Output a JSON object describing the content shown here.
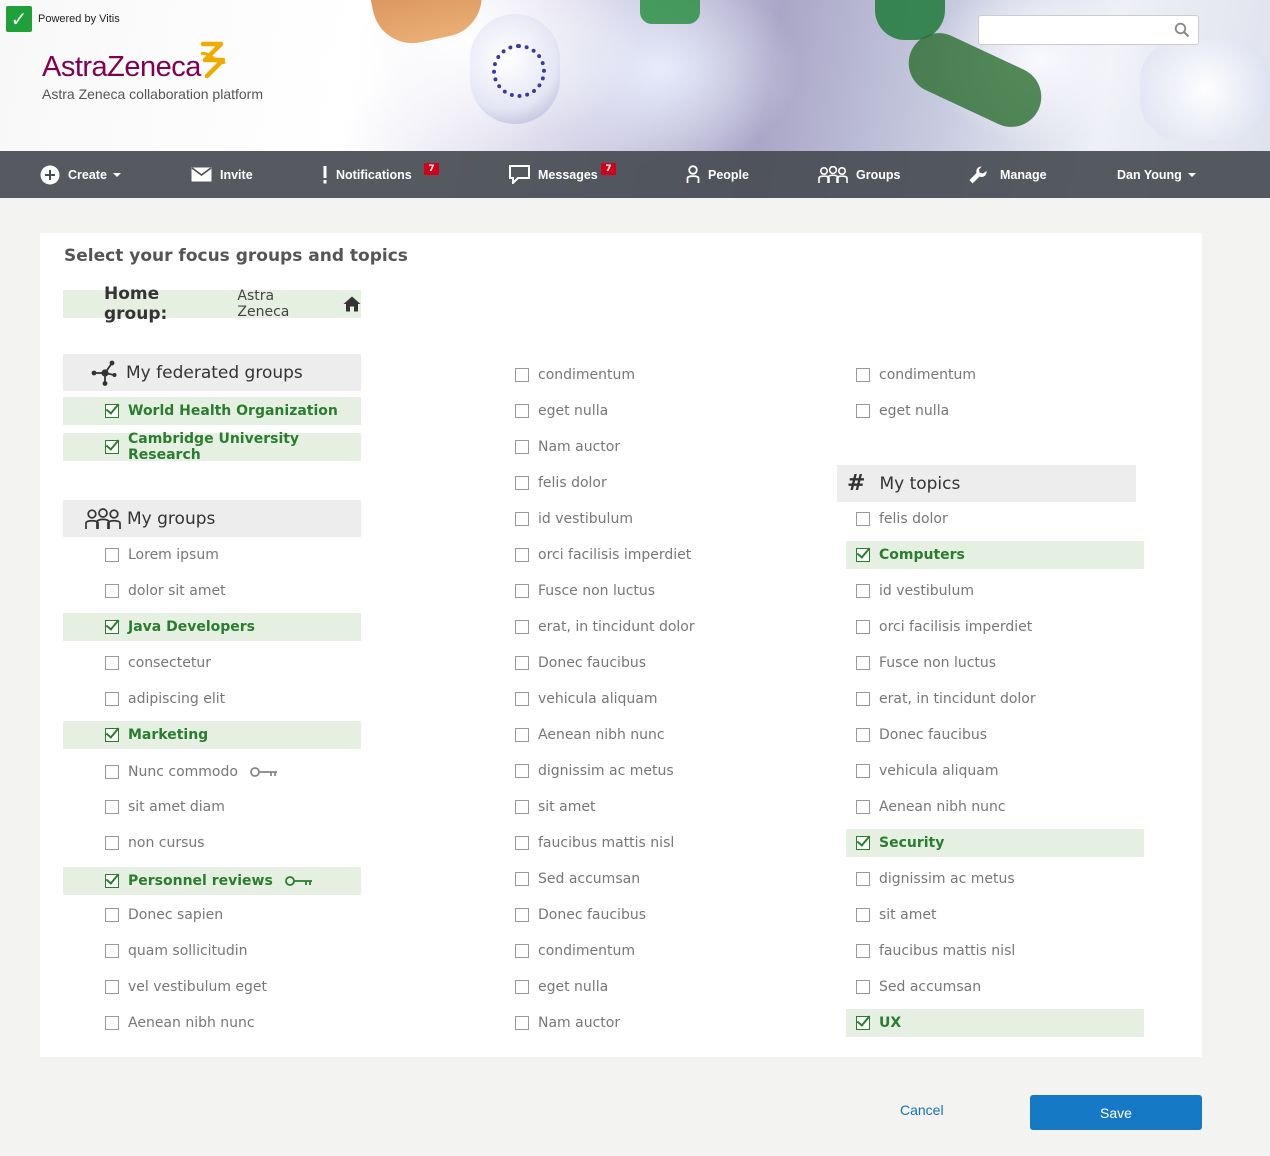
{
  "header": {
    "powered_by": "Powered by Vitis",
    "logo_text": "AstraZeneca",
    "platform_subtitle": "Astra Zeneca collaboration platform",
    "search_placeholder": "",
    "brand_color": "#830051",
    "accent_color": "#f0ab00"
  },
  "nav": {
    "create": "Create",
    "invite": "Invite",
    "notifications": "Notifications",
    "notifications_badge": "7",
    "messages": "Messages",
    "messages_badge": "7",
    "people": "People",
    "groups": "Groups",
    "manage": "Manage",
    "user": "Dan Young"
  },
  "page": {
    "title": "Select your focus groups and topics",
    "home_label": "Home group:",
    "home_value": "Astra Zeneca"
  },
  "federated": {
    "title": "My federated groups",
    "items": [
      {
        "label": "World Health Organization",
        "selected": true
      },
      {
        "label": "Cambridge University Research",
        "selected": true
      }
    ]
  },
  "groups": {
    "title": "My groups",
    "items": [
      {
        "label": "Lorem ipsum",
        "selected": false
      },
      {
        "label": "dolor sit amet",
        "selected": false
      },
      {
        "label": "Java Developers",
        "selected": true
      },
      {
        "label": "consectetur",
        "selected": false
      },
      {
        "label": "adipiscing elit",
        "selected": false
      },
      {
        "label": "Marketing",
        "selected": true
      },
      {
        "label": "Nunc commodo",
        "selected": false,
        "key": true
      },
      {
        "label": "sit amet diam",
        "selected": false
      },
      {
        "label": "non cursus",
        "selected": false
      },
      {
        "label": "Personnel reviews",
        "selected": true,
        "key": true
      },
      {
        "label": "Donec sapien",
        "selected": false
      },
      {
        "label": "quam sollicitudin",
        "selected": false
      },
      {
        "label": "vel vestibulum eget",
        "selected": false
      },
      {
        "label": "Aenean nibh nunc",
        "selected": false
      }
    ]
  },
  "column2": {
    "items": [
      "condimentum",
      "eget nulla",
      "Nam auctor",
      "felis dolor",
      "id vestibulum",
      "orci facilisis imperdiet",
      "Fusce non luctus",
      "erat, in tincidunt dolor",
      "Donec faucibus",
      "vehicula aliquam",
      "Aenean nibh nunc",
      "dignissim ac metus",
      "sit amet",
      "faucibus mattis nisl",
      "Sed accumsan",
      "Donec faucibus",
      "condimentum",
      "eget nulla",
      "Nam auctor"
    ]
  },
  "column3": {
    "items": [
      "condimentum",
      "eget nulla"
    ]
  },
  "topics": {
    "title": "My topics",
    "items": [
      {
        "label": "felis dolor",
        "selected": false
      },
      {
        "label": "Computers",
        "selected": true
      },
      {
        "label": "id vestibulum",
        "selected": false
      },
      {
        "label": "orci facilisis imperdiet",
        "selected": false
      },
      {
        "label": "Fusce non luctus",
        "selected": false
      },
      {
        "label": "erat, in tincidunt dolor",
        "selected": false
      },
      {
        "label": "Donec faucibus",
        "selected": false
      },
      {
        "label": "vehicula aliquam",
        "selected": false
      },
      {
        "label": "Aenean nibh nunc",
        "selected": false
      },
      {
        "label": "Security",
        "selected": true
      },
      {
        "label": "dignissim ac metus",
        "selected": false
      },
      {
        "label": "sit amet",
        "selected": false
      },
      {
        "label": "faucibus mattis nisl",
        "selected": false
      },
      {
        "label": "Sed accumsan",
        "selected": false
      },
      {
        "label": "UX",
        "selected": true
      }
    ]
  },
  "footer": {
    "cancel": "Cancel",
    "save": "Save",
    "save_color": "#1679c5"
  }
}
